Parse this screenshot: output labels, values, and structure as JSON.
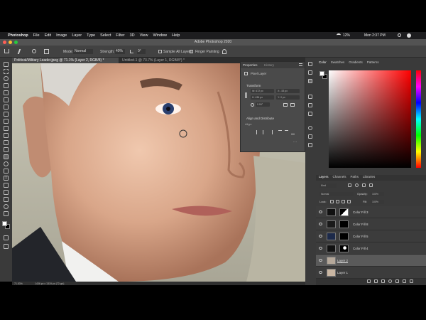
{
  "menubar": {
    "app": "Photoshop",
    "items": [
      "File",
      "Edit",
      "Image",
      "Layer",
      "Type",
      "Select",
      "Filter",
      "3D",
      "View",
      "Window",
      "Help"
    ],
    "battery": "12%",
    "clock": "Mon 2:37 PM"
  },
  "window": {
    "title": "Adobe Photoshop 2020"
  },
  "options": {
    "mode_label": "Mode:",
    "mode_value": "Normal",
    "strength_label": "Strength:",
    "strength_value": "40%",
    "angle_value": "0°",
    "sample_all": "Sample All Layers",
    "finger_painting": "Finger Painting"
  },
  "tabs": [
    {
      "label": "Political/Military Leader.jpeg @ 71.1% (Layer 2, RGB/8) *",
      "active": true
    },
    {
      "label": "Untitled-1 @ 73.7% (Layer 1, RGB/8*) *",
      "active": false
    }
  ],
  "status": {
    "zoom": "71.53%",
    "doc": "1436 px x 1319 px (72 ppi)"
  },
  "properties": {
    "tab1": "Properties",
    "tab2": "History",
    "kind": "Pixel Layer",
    "transform": "Transform",
    "w": "W: 672 px",
    "x": "X: -53 px",
    "h": "H: 436 px",
    "y": "Y: 0 px",
    "angle": "0.00°",
    "align": "Align and Distribute",
    "align_sub": "Align:"
  },
  "color_panel": {
    "tabs": [
      "Color",
      "Swatches",
      "Gradients",
      "Patterns"
    ]
  },
  "layers_panel": {
    "tabs": [
      "Layers",
      "Channels",
      "Paths",
      "Libraries"
    ],
    "kind": "Kind",
    "blend": "Normal",
    "opacity_label": "Opacity:",
    "opacity": "100%",
    "lock_label": "Lock:",
    "fill_label": "Fill:",
    "fill": "100%",
    "layers": [
      {
        "name": "Color Fill 3",
        "selected": false
      },
      {
        "name": "Color Fill 8",
        "selected": false
      },
      {
        "name": "Color Fill 5",
        "selected": false
      },
      {
        "name": "Color Fill 4",
        "selected": false
      },
      {
        "name": "Layer 2",
        "selected": true
      },
      {
        "name": "Layer 1",
        "selected": false
      }
    ]
  },
  "colors": {
    "accent": "#2c6fd1",
    "panel": "#3a3a3a",
    "selected": "#5a5a5a"
  },
  "icons": [
    "apple-icon",
    "home-icon",
    "smudge-icon",
    "brush-icon",
    "eye-icon",
    "search-icon",
    "wifi-icon",
    "battery-icon"
  ]
}
